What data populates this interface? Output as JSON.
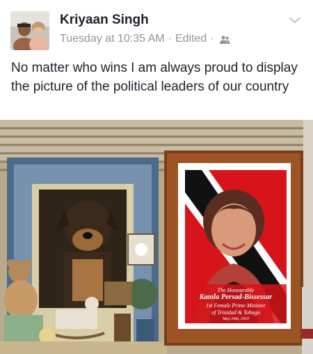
{
  "post": {
    "author": {
      "name": "Kriyaan Singh",
      "avatar_icon": "profile-photo"
    },
    "meta": {
      "time": "Tuesday at 10:35 AM",
      "separator": "·",
      "edited": "Edited",
      "audience_icon": "friends-icon"
    },
    "menu_icon": "chevron-down-icon",
    "text": "No matter who wins I am always proud to display the picture of the political leaders of our country",
    "photo": {
      "plaque": {
        "line1": "The Honourable",
        "line2": "Kamla Persad-Bissessar",
        "line3": "1st Female Prime Minister",
        "line4": "of Trinidad & Tobago",
        "line5": "May 24th, 2010"
      }
    }
  },
  "colors": {
    "name": "#1d2129",
    "meta": "#90949c",
    "flag_red": "#d7141a",
    "flag_black": "#111111"
  }
}
